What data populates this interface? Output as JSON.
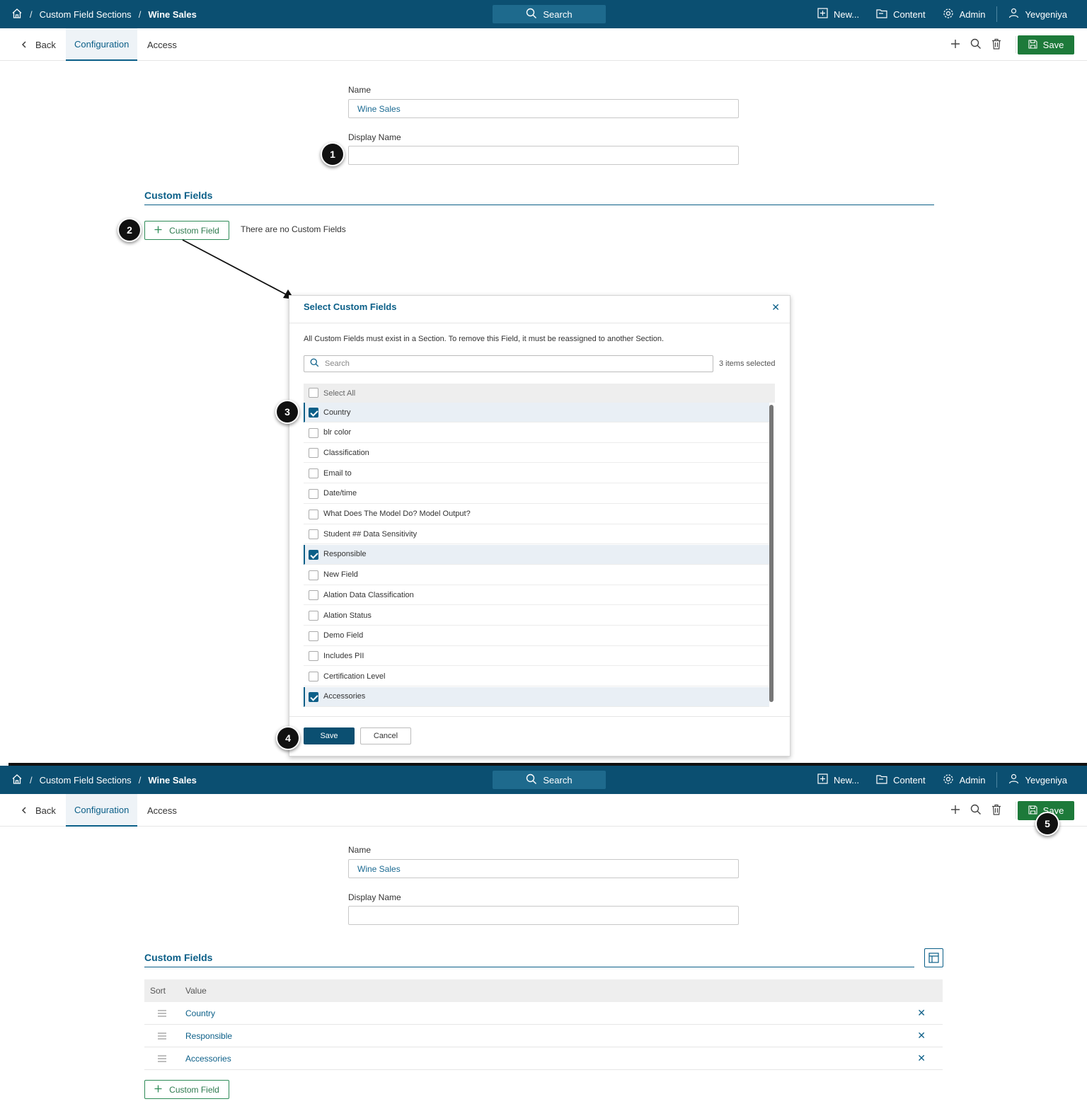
{
  "topbar": {
    "breadcrumb_parent": "Custom Field Sections",
    "breadcrumb_current": "Wine Sales",
    "search_label": "Search",
    "new_label": "New...",
    "content_label": "Content",
    "admin_label": "Admin",
    "user_label": "Yevgeniya"
  },
  "subbar": {
    "back_label": "Back",
    "tab_configuration": "Configuration",
    "tab_access": "Access",
    "save_label": "Save"
  },
  "form": {
    "name_label": "Name",
    "name_value": "Wine Sales",
    "display_name_label": "Display Name",
    "display_name_value": ""
  },
  "custom_fields": {
    "title": "Custom Fields",
    "add_label": "Custom Field",
    "empty_text": "There are no Custom Fields"
  },
  "modal": {
    "title": "Select Custom Fields",
    "description": "All Custom Fields must exist in a Section. To remove this Field, it must be reassigned to another Section.",
    "search_placeholder": "Search",
    "selected_count": "3 items selected",
    "select_all_label": "Select All",
    "items": [
      {
        "label": "Country",
        "checked": true
      },
      {
        "label": "blr color",
        "checked": false
      },
      {
        "label": "Classification",
        "checked": false
      },
      {
        "label": "Email to",
        "checked": false
      },
      {
        "label": "Date/time",
        "checked": false
      },
      {
        "label": "What Does The Model Do? Model Output?",
        "checked": false
      },
      {
        "label": "Student ## Data Sensitivity",
        "checked": false
      },
      {
        "label": "Responsible",
        "checked": true
      },
      {
        "label": "New Field",
        "checked": false
      },
      {
        "label": "Alation Data Classification",
        "checked": false
      },
      {
        "label": "Alation Status",
        "checked": false
      },
      {
        "label": "Demo Field",
        "checked": false
      },
      {
        "label": "Includes PII",
        "checked": false
      },
      {
        "label": "Certification Level",
        "checked": false
      },
      {
        "label": "Accessories",
        "checked": true
      }
    ],
    "save_label": "Save",
    "cancel_label": "Cancel"
  },
  "result_table": {
    "col_sort": "Sort",
    "col_value": "Value",
    "rows": [
      "Country",
      "Responsible",
      "Accessories"
    ]
  },
  "badges": [
    "1",
    "2",
    "3",
    "4",
    "5"
  ],
  "colors": {
    "topbar": "#0b4f71",
    "accent": "#0b5f88",
    "save_green": "#1d7a3a"
  }
}
